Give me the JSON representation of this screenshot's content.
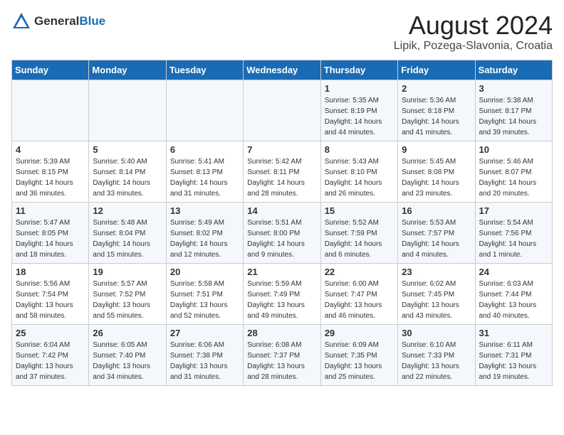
{
  "logo": {
    "general": "General",
    "blue": "Blue"
  },
  "title": "August 2024",
  "location": "Lipik, Pozega-Slavonia, Croatia",
  "days_of_week": [
    "Sunday",
    "Monday",
    "Tuesday",
    "Wednesday",
    "Thursday",
    "Friday",
    "Saturday"
  ],
  "weeks": [
    [
      {
        "day": "",
        "info": ""
      },
      {
        "day": "",
        "info": ""
      },
      {
        "day": "",
        "info": ""
      },
      {
        "day": "",
        "info": ""
      },
      {
        "day": "1",
        "info": "Sunrise: 5:35 AM\nSunset: 8:19 PM\nDaylight: 14 hours\nand 44 minutes."
      },
      {
        "day": "2",
        "info": "Sunrise: 5:36 AM\nSunset: 8:18 PM\nDaylight: 14 hours\nand 41 minutes."
      },
      {
        "day": "3",
        "info": "Sunrise: 5:38 AM\nSunset: 8:17 PM\nDaylight: 14 hours\nand 39 minutes."
      }
    ],
    [
      {
        "day": "4",
        "info": "Sunrise: 5:39 AM\nSunset: 8:15 PM\nDaylight: 14 hours\nand 36 minutes."
      },
      {
        "day": "5",
        "info": "Sunrise: 5:40 AM\nSunset: 8:14 PM\nDaylight: 14 hours\nand 33 minutes."
      },
      {
        "day": "6",
        "info": "Sunrise: 5:41 AM\nSunset: 8:13 PM\nDaylight: 14 hours\nand 31 minutes."
      },
      {
        "day": "7",
        "info": "Sunrise: 5:42 AM\nSunset: 8:11 PM\nDaylight: 14 hours\nand 28 minutes."
      },
      {
        "day": "8",
        "info": "Sunrise: 5:43 AM\nSunset: 8:10 PM\nDaylight: 14 hours\nand 26 minutes."
      },
      {
        "day": "9",
        "info": "Sunrise: 5:45 AM\nSunset: 8:08 PM\nDaylight: 14 hours\nand 23 minutes."
      },
      {
        "day": "10",
        "info": "Sunrise: 5:46 AM\nSunset: 8:07 PM\nDaylight: 14 hours\nand 20 minutes."
      }
    ],
    [
      {
        "day": "11",
        "info": "Sunrise: 5:47 AM\nSunset: 8:05 PM\nDaylight: 14 hours\nand 18 minutes."
      },
      {
        "day": "12",
        "info": "Sunrise: 5:48 AM\nSunset: 8:04 PM\nDaylight: 14 hours\nand 15 minutes."
      },
      {
        "day": "13",
        "info": "Sunrise: 5:49 AM\nSunset: 8:02 PM\nDaylight: 14 hours\nand 12 minutes."
      },
      {
        "day": "14",
        "info": "Sunrise: 5:51 AM\nSunset: 8:00 PM\nDaylight: 14 hours\nand 9 minutes."
      },
      {
        "day": "15",
        "info": "Sunrise: 5:52 AM\nSunset: 7:59 PM\nDaylight: 14 hours\nand 6 minutes."
      },
      {
        "day": "16",
        "info": "Sunrise: 5:53 AM\nSunset: 7:57 PM\nDaylight: 14 hours\nand 4 minutes."
      },
      {
        "day": "17",
        "info": "Sunrise: 5:54 AM\nSunset: 7:56 PM\nDaylight: 14 hours\nand 1 minute."
      }
    ],
    [
      {
        "day": "18",
        "info": "Sunrise: 5:56 AM\nSunset: 7:54 PM\nDaylight: 13 hours\nand 58 minutes."
      },
      {
        "day": "19",
        "info": "Sunrise: 5:57 AM\nSunset: 7:52 PM\nDaylight: 13 hours\nand 55 minutes."
      },
      {
        "day": "20",
        "info": "Sunrise: 5:58 AM\nSunset: 7:51 PM\nDaylight: 13 hours\nand 52 minutes."
      },
      {
        "day": "21",
        "info": "Sunrise: 5:59 AM\nSunset: 7:49 PM\nDaylight: 13 hours\nand 49 minutes."
      },
      {
        "day": "22",
        "info": "Sunrise: 6:00 AM\nSunset: 7:47 PM\nDaylight: 13 hours\nand 46 minutes."
      },
      {
        "day": "23",
        "info": "Sunrise: 6:02 AM\nSunset: 7:45 PM\nDaylight: 13 hours\nand 43 minutes."
      },
      {
        "day": "24",
        "info": "Sunrise: 6:03 AM\nSunset: 7:44 PM\nDaylight: 13 hours\nand 40 minutes."
      }
    ],
    [
      {
        "day": "25",
        "info": "Sunrise: 6:04 AM\nSunset: 7:42 PM\nDaylight: 13 hours\nand 37 minutes."
      },
      {
        "day": "26",
        "info": "Sunrise: 6:05 AM\nSunset: 7:40 PM\nDaylight: 13 hours\nand 34 minutes."
      },
      {
        "day": "27",
        "info": "Sunrise: 6:06 AM\nSunset: 7:38 PM\nDaylight: 13 hours\nand 31 minutes."
      },
      {
        "day": "28",
        "info": "Sunrise: 6:08 AM\nSunset: 7:37 PM\nDaylight: 13 hours\nand 28 minutes."
      },
      {
        "day": "29",
        "info": "Sunrise: 6:09 AM\nSunset: 7:35 PM\nDaylight: 13 hours\nand 25 minutes."
      },
      {
        "day": "30",
        "info": "Sunrise: 6:10 AM\nSunset: 7:33 PM\nDaylight: 13 hours\nand 22 minutes."
      },
      {
        "day": "31",
        "info": "Sunrise: 6:11 AM\nSunset: 7:31 PM\nDaylight: 13 hours\nand 19 minutes."
      }
    ]
  ]
}
